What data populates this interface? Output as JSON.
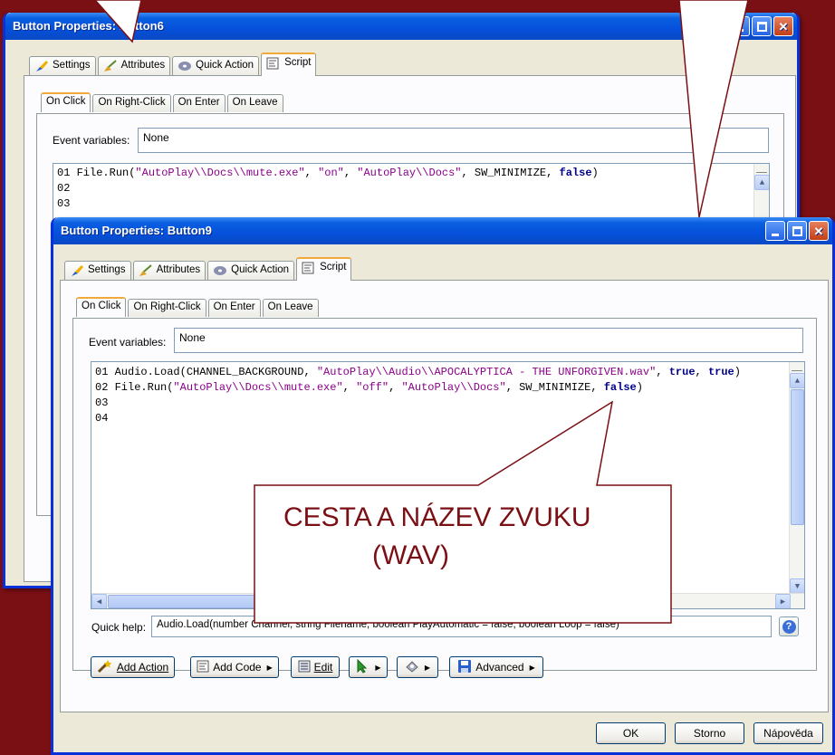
{
  "back_window": {
    "title": "Button Properties: Button6",
    "tabs": [
      {
        "label": "Settings",
        "icon": "brush-icon"
      },
      {
        "label": "Attributes",
        "icon": "broom-icon"
      },
      {
        "label": "Quick Action",
        "icon": "disc-icon"
      },
      {
        "label": "Script",
        "icon": "script-icon",
        "active": true
      }
    ],
    "event_tabs": [
      "On Click",
      "On Right-Click",
      "On Enter",
      "On Leave"
    ],
    "event_variables_label": "Event variables:",
    "event_variables_value": "None",
    "code_lines": [
      {
        "num": "01",
        "segments": [
          {
            "t": " File.Run(",
            "c": ""
          },
          {
            "t": "\"AutoPlay\\\\Docs\\\\mute.exe\"",
            "c": "str"
          },
          {
            "t": ", ",
            "c": ""
          },
          {
            "t": "\"on\"",
            "c": "str"
          },
          {
            "t": ", ",
            "c": ""
          },
          {
            "t": "\"AutoPlay\\\\Docs\"",
            "c": "str"
          },
          {
            "t": ", SW_MINIMIZE, ",
            "c": ""
          },
          {
            "t": "false",
            "c": "kw"
          },
          {
            "t": ")",
            "c": ""
          }
        ]
      },
      {
        "num": "02",
        "segments": []
      },
      {
        "num": "03",
        "segments": []
      }
    ]
  },
  "front_window": {
    "title": "Button Properties: Button9",
    "tabs": [
      {
        "label": "Settings",
        "icon": "brush-icon"
      },
      {
        "label": "Attributes",
        "icon": "broom-icon"
      },
      {
        "label": "Quick Action",
        "icon": "disc-icon"
      },
      {
        "label": "Script",
        "icon": "script-icon",
        "active": true
      }
    ],
    "event_tabs": [
      "On Click",
      "On Right-Click",
      "On Enter",
      "On Leave"
    ],
    "event_variables_label": "Event variables:",
    "event_variables_value": "None",
    "code_lines": [
      {
        "num": "01",
        "segments": [
          {
            "t": " Audio.Load(CHANNEL_BACKGROUND, ",
            "c": ""
          },
          {
            "t": "\"AutoPlay\\\\Audio\\\\APOCALYPTICA - THE UNFORGIVEN.wav\"",
            "c": "str"
          },
          {
            "t": ", ",
            "c": ""
          },
          {
            "t": "true",
            "c": "kw"
          },
          {
            "t": ", ",
            "c": ""
          },
          {
            "t": "true",
            "c": "kw"
          },
          {
            "t": ")",
            "c": ""
          }
        ]
      },
      {
        "num": "02",
        "segments": [
          {
            "t": " File.Run(",
            "c": ""
          },
          {
            "t": "\"AutoPlay\\\\Docs\\\\mute.exe\"",
            "c": "str"
          },
          {
            "t": ", ",
            "c": ""
          },
          {
            "t": "\"off\"",
            "c": "str"
          },
          {
            "t": ", ",
            "c": ""
          },
          {
            "t": "\"AutoPlay\\\\Docs\"",
            "c": "str"
          },
          {
            "t": ", SW_MINIMIZE, ",
            "c": ""
          },
          {
            "t": "false",
            "c": "kw"
          },
          {
            "t": ")",
            "c": ""
          }
        ]
      },
      {
        "num": "03",
        "segments": []
      },
      {
        "num": "04",
        "segments": []
      }
    ],
    "quick_help_label": "Quick help:",
    "quick_help_value": "Audio.Load(number Channel, string Filename, boolean PlayAutomatic = false, boolean Loop = false)",
    "action_buttons": [
      {
        "label": "Add Action",
        "icon": "wand-icon",
        "dropdown": false
      },
      {
        "label": "Add Code",
        "icon": "code-icon",
        "dropdown": true
      },
      {
        "label": "Edit",
        "icon": "edit-icon",
        "dropdown": false
      },
      {
        "label": "",
        "icon": "cursor-icon",
        "dropdown": true
      },
      {
        "label": "",
        "icon": "tool-icon",
        "dropdown": true
      },
      {
        "label": "Advanced",
        "icon": "save-icon",
        "dropdown": true
      }
    ],
    "dialog_buttons": {
      "ok": "OK",
      "cancel": "Storno",
      "help": "Nápověda"
    }
  },
  "callout": {
    "line1": "CESTA A NÁZEV ZVUKU",
    "line2": "(WAV)",
    "fill": "#ffffff",
    "stroke": "#7a0f14"
  },
  "colors": {
    "background": "#7a0f14",
    "title_blue": "#0550db",
    "string_color": "#8b008b",
    "keyword_color": "#00008b"
  }
}
